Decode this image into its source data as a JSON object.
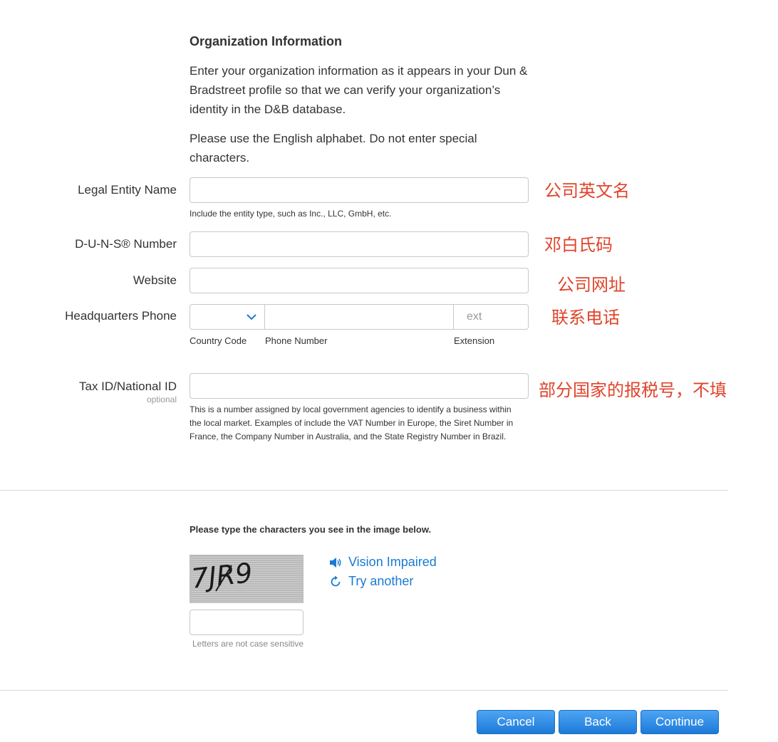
{
  "section": {
    "title": "Organization Information",
    "intro": "Enter your organization information as it appears in your Dun & Bradstreet profile so that we can verify your organization’s identity in the D&B database.",
    "alphabet_note": "Please use the English alphabet. Do not enter special characters."
  },
  "fields": {
    "legal_entity": {
      "label": "Legal Entity Name",
      "value": "",
      "hint": "Include the entity type, such as Inc., LLC, GmbH, etc.",
      "annotation": "公司英文名"
    },
    "duns": {
      "label": "D-U-N-S® Number",
      "value": "",
      "annotation": "邓白氏码"
    },
    "website": {
      "label": "Website",
      "value": "",
      "annotation": "公司网址"
    },
    "phone": {
      "label": "Headquarters Phone",
      "country_code": "",
      "number": "",
      "extension_placeholder": "ext",
      "country_code_caption": "Country Code",
      "number_caption": "Phone Number",
      "extension_caption": "Extension",
      "annotation": "联系电话"
    },
    "tax_id": {
      "label": "Tax ID/National ID",
      "optional": "optional",
      "value": "",
      "hint": "This is a number assigned by local government agencies to identify a business within the local market. Examples of include the VAT Number in Europe, the Siret Number in France, the Company Number in Australia, and the State Registry Number in Brazil.",
      "annotation": "部分国家的报税号，不填"
    }
  },
  "captcha": {
    "prompt": "Please type the characters you see in the image below.",
    "image_text": "7JR9",
    "vision_impaired": "Vision Impaired",
    "try_another": "Try another",
    "value": "",
    "hint": "Letters are not case sensitive"
  },
  "buttons": {
    "cancel": "Cancel",
    "back": "Back",
    "continue": "Continue"
  },
  "icons": {
    "chevron": "chevron-down-icon",
    "speaker": "speaker-icon",
    "refresh": "refresh-icon"
  },
  "colors": {
    "accent": "#1a7ad4",
    "annotation": "#e0442b",
    "button": "#2a86e0"
  }
}
